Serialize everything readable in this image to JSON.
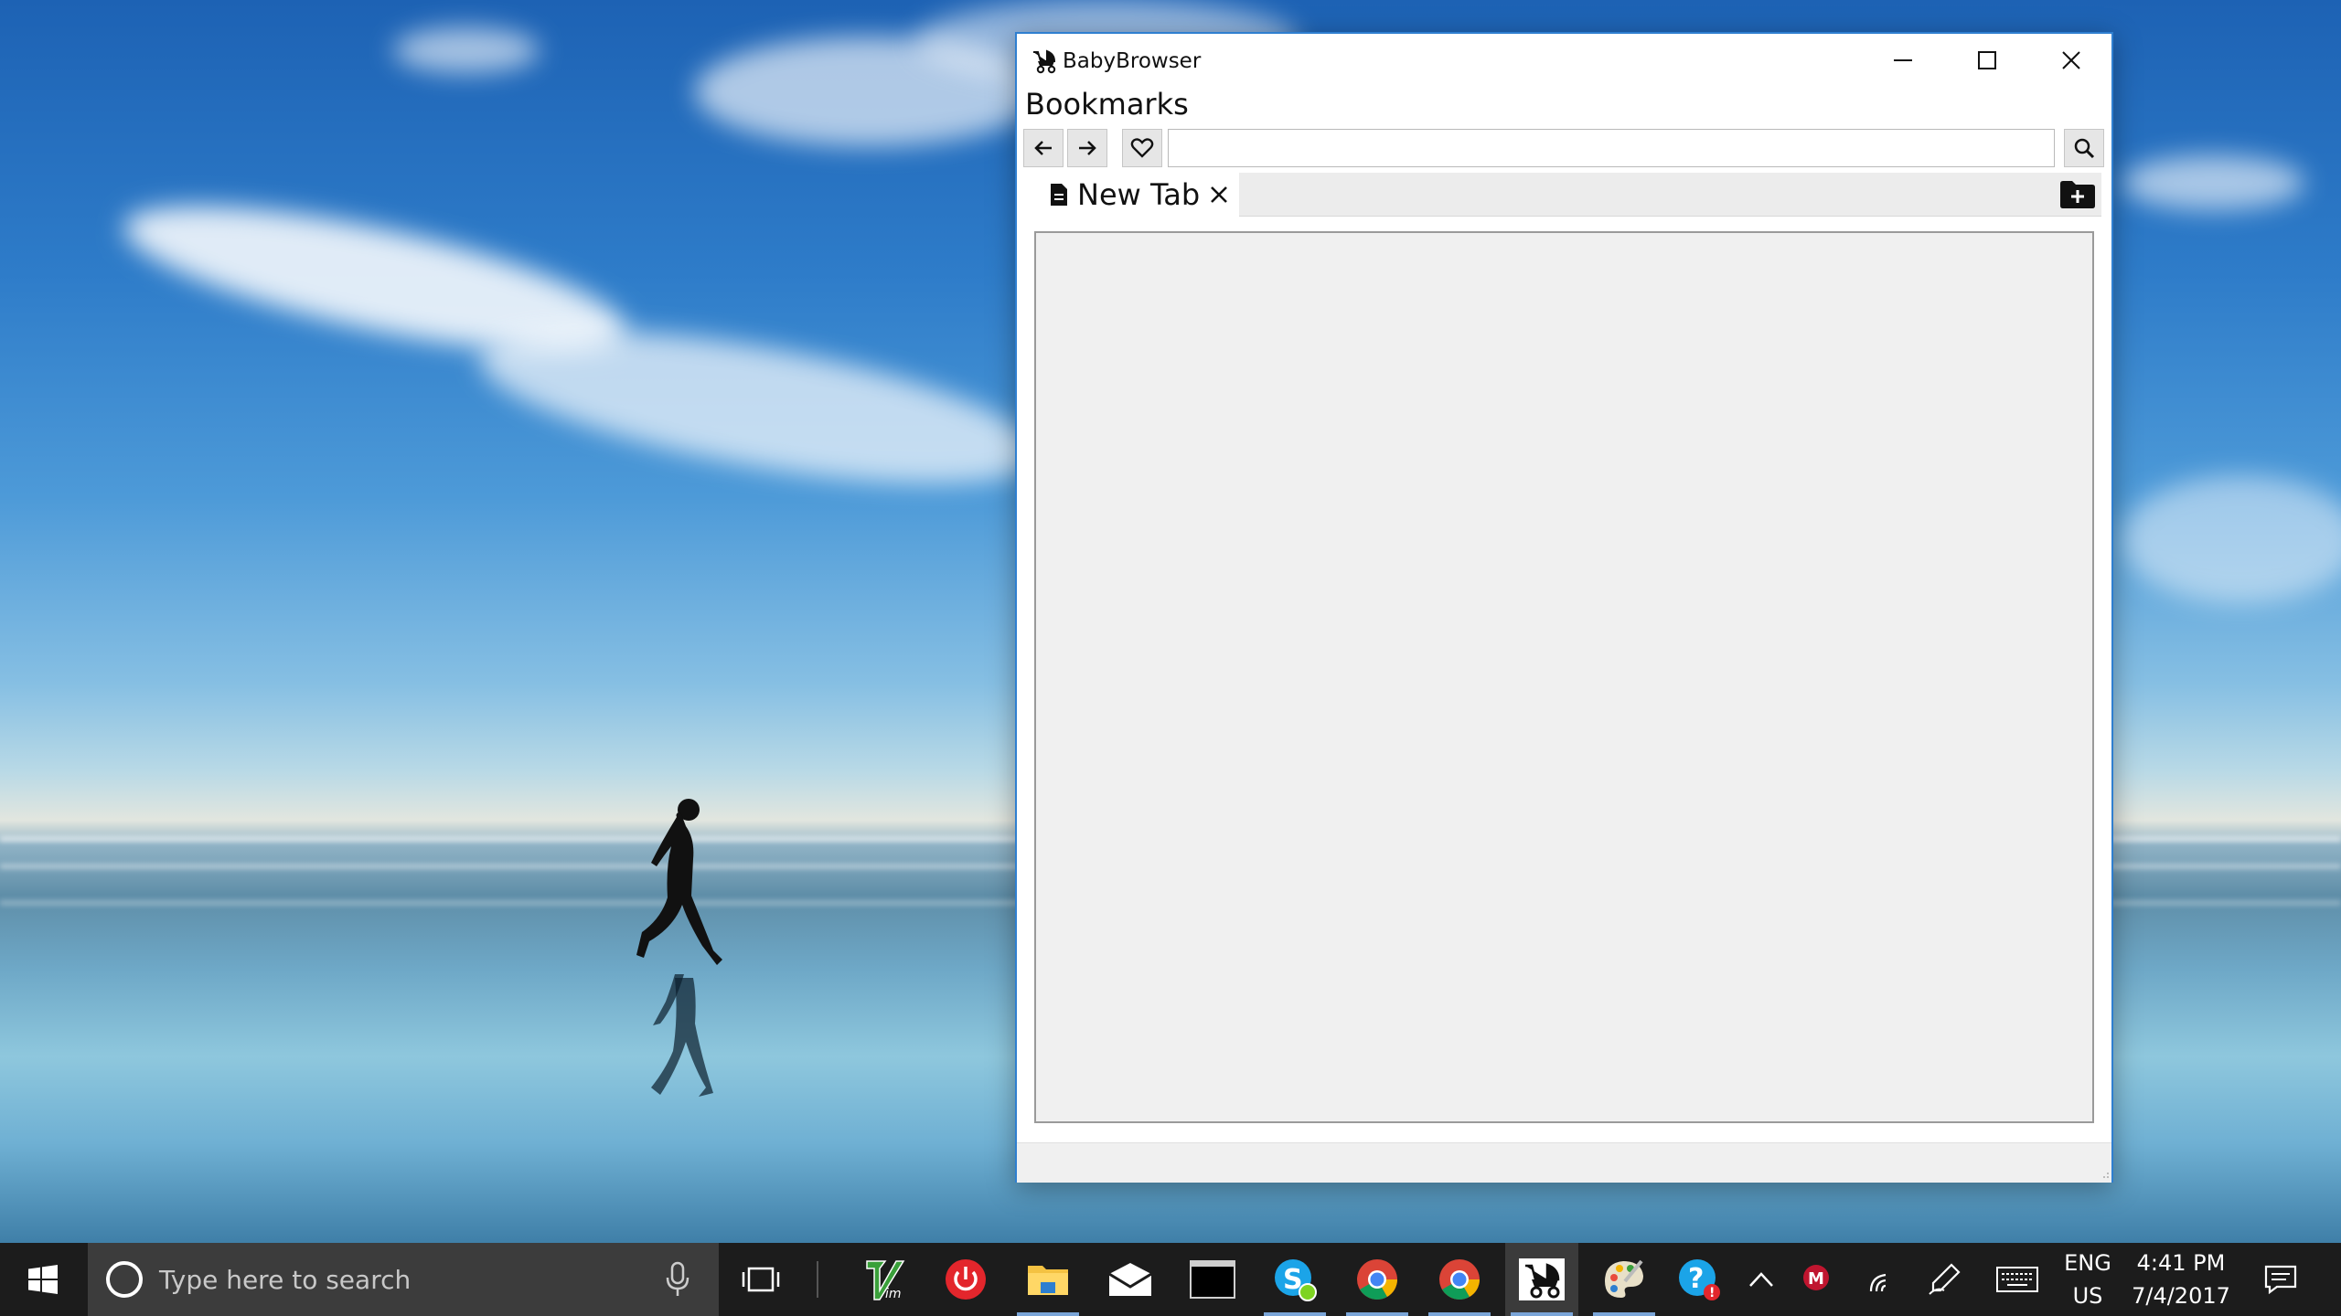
{
  "window": {
    "title": "BabyBrowser",
    "menu_label": "Bookmarks",
    "url_value": "",
    "tabs": [
      {
        "label": "New Tab"
      }
    ]
  },
  "icons": {
    "app": "stroller-icon",
    "back": "arrow-left-icon",
    "forward": "arrow-right-icon",
    "bookmark": "heart-icon",
    "search": "magnifier-icon",
    "tab": "document-icon",
    "tab_close": "close-icon",
    "new_tab": "folder-plus-icon"
  },
  "taskbar": {
    "search_placeholder": "Type here to search",
    "apps": [
      {
        "name": "vim",
        "running": false
      },
      {
        "name": "power",
        "running": false
      },
      {
        "name": "file-explorer",
        "running": true
      },
      {
        "name": "mail",
        "running": false
      },
      {
        "name": "terminal",
        "running": false
      },
      {
        "name": "skype",
        "running": true
      },
      {
        "name": "chrome",
        "running": true
      },
      {
        "name": "chrome-2",
        "running": true
      },
      {
        "name": "babybrowser",
        "running": true,
        "active": true
      },
      {
        "name": "paint",
        "running": true
      },
      {
        "name": "help",
        "running": false
      }
    ],
    "tray": {
      "language_line1": "ENG",
      "language_line2": "US",
      "time": "4:41 PM",
      "date": "7/4/2017"
    }
  },
  "colors": {
    "window_border": "#2f7fd0",
    "taskbar": "#1c1c1c",
    "running_indicator": "#7aa5d8"
  }
}
